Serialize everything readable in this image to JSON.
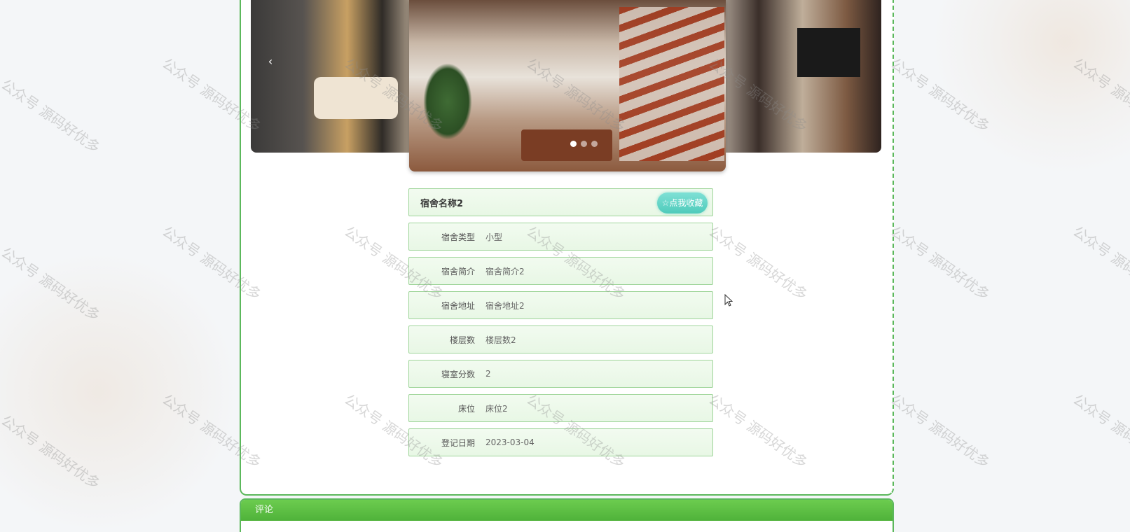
{
  "carousel": {
    "prev_symbol": "‹",
    "dots": 3,
    "active_dot": 0
  },
  "detail": {
    "title": "宿舍名称2",
    "favorite_button": "☆点我收藏",
    "fields": [
      {
        "label": "宿舍类型",
        "value": "小型"
      },
      {
        "label": "宿舍简介",
        "value": "宿舍简介2"
      },
      {
        "label": "宿舍地址",
        "value": "宿舍地址2"
      },
      {
        "label": "楼层数",
        "value": "楼层数2"
      },
      {
        "label": "寝室分数",
        "value": "2"
      },
      {
        "label": "床位",
        "value": "床位2"
      },
      {
        "label": "登记日期",
        "value": "2023-03-04"
      }
    ]
  },
  "comments": {
    "header": "评论"
  },
  "watermark": "公众号 源码好优多",
  "colors": {
    "accent_green": "#5cb85c",
    "favorite_teal": "#4fcbbb"
  }
}
